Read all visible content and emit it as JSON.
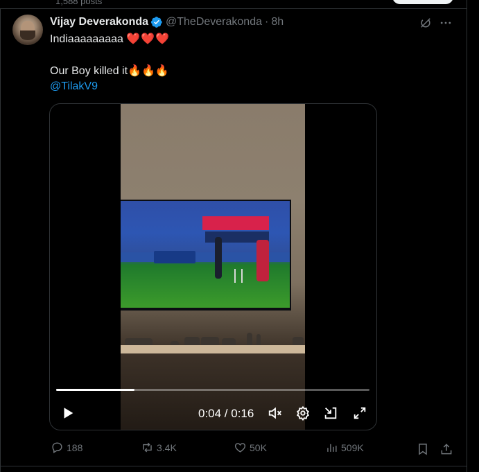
{
  "profile_header": {
    "posts_count": "1,588 posts"
  },
  "tweet": {
    "author": {
      "display_name": "Vijay Deverakonda",
      "handle": "@TheDeverakonda",
      "time": "8h",
      "separator": "·"
    },
    "text_line1": "Indiaaaaaaaaa",
    "hearts": "❤️❤️❤️",
    "text_line2": "Our Boy killed it🔥🔥🔥",
    "mention": "@TilakV9",
    "video": {
      "current_time": "0:04",
      "duration": "0:16",
      "time_label": "0:04 / 0:16",
      "progress": 0.25
    },
    "stats": {
      "replies": "188",
      "reposts": "3.4K",
      "likes": "50K",
      "views": "509K"
    }
  },
  "colors": {
    "background": "#000000",
    "text_primary": "#e7e9ea",
    "text_secondary": "#71767b",
    "accent_blue": "#1d9bf0",
    "heart_red": "#f91880",
    "border": "#2f3336"
  },
  "icons": {
    "verified": "verified-badge-icon",
    "grok": "grok-icon",
    "more": "more-icon",
    "play": "play-icon",
    "mute": "mute-icon",
    "settings": "gear-icon",
    "minimize": "minimize-icon",
    "fullscreen": "fullscreen-icon",
    "reply": "reply-icon",
    "repost": "repost-icon",
    "like": "heart-icon",
    "views": "views-icon",
    "bookmark": "bookmark-icon",
    "share": "share-icon"
  }
}
